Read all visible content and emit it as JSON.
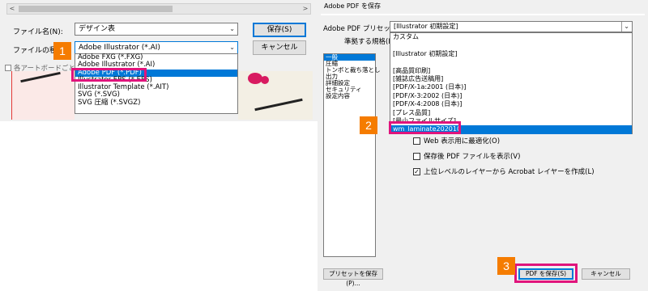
{
  "save_dialog": {
    "filename_label": "ファイル名(N):",
    "filename_value": "デザイン表",
    "filetype_label": "ファイルの種類",
    "filetype_selected": "Adobe Illustrator (*.AI)",
    "save_button": "保存(S)",
    "cancel_button": "キャンセル",
    "artboard_checkbox_label": "各アートボードごとに(G)",
    "filetype_options": [
      "Adobe FXG (*.FXG)",
      "Adobe Illustrator (*.AI)",
      "Adobe PDF (*.PDF)",
      "Illustrator EPS (*.EPS)",
      "Illustrator Template (*.AIT)",
      "SVG (*.SVG)",
      "SVG 圧縮 (*.SVGZ)"
    ],
    "selected_option_index": 2
  },
  "pdf_dialog": {
    "window_title": "Adobe PDF を保存",
    "preset_label": "Adobe PDF プリセット(A):",
    "preset_value": "[Illustrator 初期設定]",
    "standard_label": "準拠する規格(N):",
    "preset_options": [
      "カスタム",
      "",
      "[Illustrator 初期設定]",
      "",
      "[高品質印刷]",
      "[雑誌広告送稿用]",
      "[PDF/X-1a:2001 (日本)]",
      "[PDF/X-3:2002 (日本)]",
      "[PDF/X-4:2008 (日本)]",
      "[プレス品質]",
      "[最小ファイルサイズ]",
      "wm_laminate202010"
    ],
    "selected_preset_index": 11,
    "nav_items": [
      "一般",
      "圧縮",
      "トンボと裁ち落とし",
      "出力",
      "詳細設定",
      "セキュリティ",
      "設定内容"
    ],
    "selected_nav_index": 0,
    "options": [
      {
        "label": "Web 表示用に最適化(O)",
        "checked": false
      },
      {
        "label": "保存後 PDF ファイルを表示(V)",
        "checked": false
      },
      {
        "label": "上位レベルのレイヤーから Acrobat レイヤーを作成(L)",
        "checked": true
      }
    ],
    "save_preset_button": "プリセットを保存(P)...",
    "save_pdf_button": "PDF を保存(S)",
    "cancel_button": "キャンセル"
  },
  "step_badges": [
    "1",
    "2",
    "3"
  ],
  "colors": {
    "highlight": "#e0147c",
    "badge": "#f57c00",
    "selection": "#0078d7"
  }
}
